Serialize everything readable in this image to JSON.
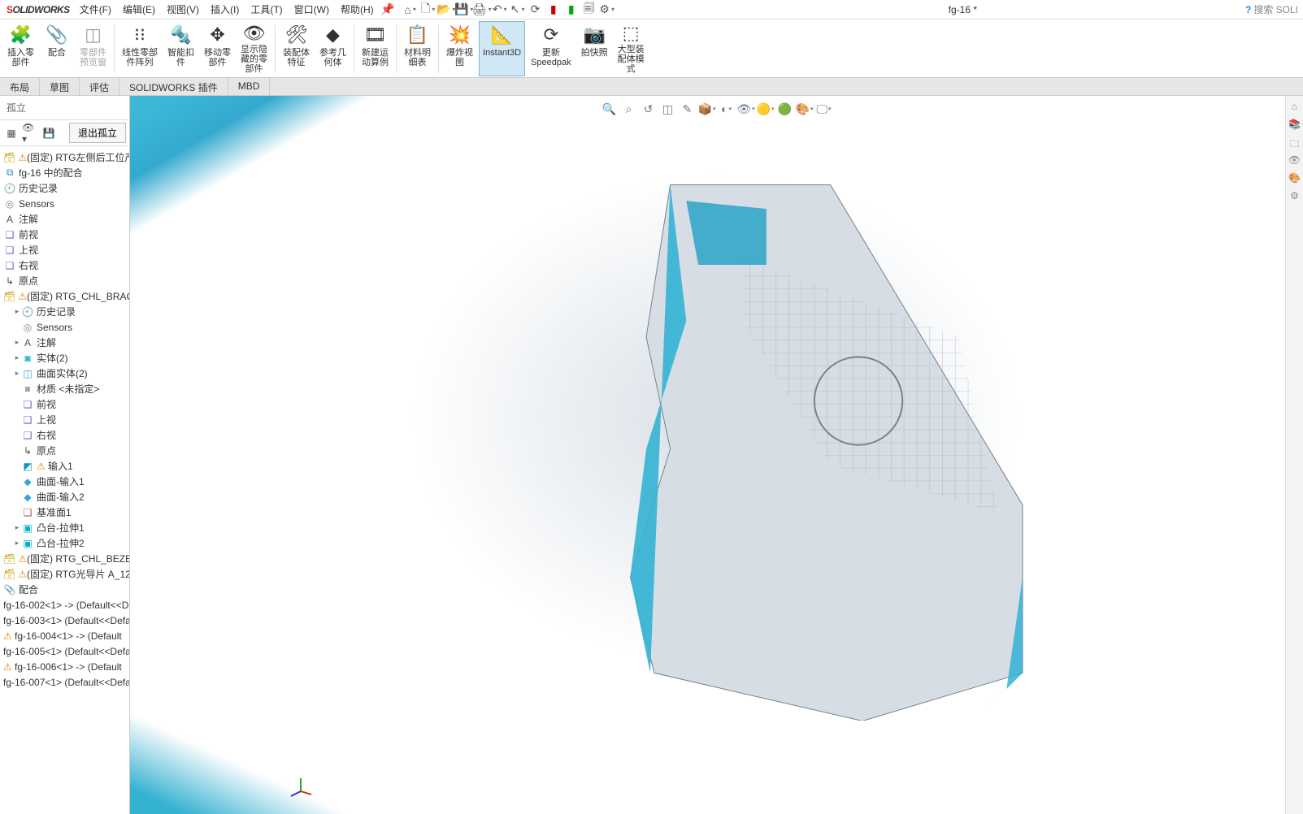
{
  "app": {
    "logo_s": "S",
    "logo_w": "OLIDWORKS",
    "doc": "fg-16 *",
    "search_ph": "搜索 SOLI"
  },
  "menu": {
    "file": "文件(F)",
    "edit": "编辑(E)",
    "view": "视图(V)",
    "insert": "插入(I)",
    "tools": "工具(T)",
    "window": "窗口(W)",
    "help": "帮助(H)"
  },
  "ribbon": {
    "insert_part": "插入零\n部件",
    "mate": "配合",
    "preview": "零部件\n预览窗",
    "linear": "线性零部\n件阵列",
    "smart": "智能扣\n件",
    "move": "移动零\n部件",
    "show_hide": "显示隐\n藏的零\n部件",
    "asm_feat": "装配体\n特征",
    "ref_geo": "参考几\n何体",
    "motion": "新建运\n动算例",
    "bom": "材料明\n细表",
    "explode": "爆炸视\n图",
    "instant3d": "Instant3D",
    "speedpak": "更新\nSpeedpak",
    "snapshot": "拍快照",
    "large": "大型装\n配体模\n式"
  },
  "cmtabs": {
    "layout": "布局",
    "sketch": "草图",
    "evaluate": "评估",
    "swaddins": "SOLIDWORKS 插件",
    "mbd": "MBD"
  },
  "panel": {
    "title": "孤立",
    "exit": "退出孤立"
  },
  "tree": {
    "root": "(固定) RTG左侧后工位产品-<",
    "mates": "fg-16 中的配合",
    "hist": "历史记录",
    "sensors": "Sensors",
    "notes": "注解",
    "front": "前视",
    "top": "上视",
    "right": "右视",
    "origin": "原点",
    "sub_brack": "(固定) RTG_CHL_BRACK",
    "sub_hist": "历史记录",
    "sub_sensors": "Sensors",
    "sub_notes": "注解",
    "solids": "实体(2)",
    "surfaces": "曲面实体(2)",
    "material": "材质 <未指定>",
    "sub_front": "前视",
    "sub_top": "上视",
    "sub_right": "右视",
    "sub_origin": "原点",
    "imp1": "输入1",
    "surf_imp1": "曲面-输入1",
    "surf_imp2": "曲面-输入2",
    "datum1": "基准面1",
    "extr1": "凸台-拉伸1",
    "extr2": "凸台-拉伸2",
    "sub_bezel": "(固定) RTG_CHL_BEZEL",
    "sub_light": "(固定) RTG光导片 A_12",
    "mates2": "配合",
    "fg2": "fg-16-002<1> -> (Default<<D",
    "fg3": "fg-16-003<1> (Default<<Defa",
    "fg4": "fg-16-004<1> -> (Default",
    "fg5": "fg-16-005<1> (Default<<Defa",
    "fg6": "fg-16-006<1> -> (Default",
    "fg7": "fg-16-007<1> (Default<<Defa"
  }
}
